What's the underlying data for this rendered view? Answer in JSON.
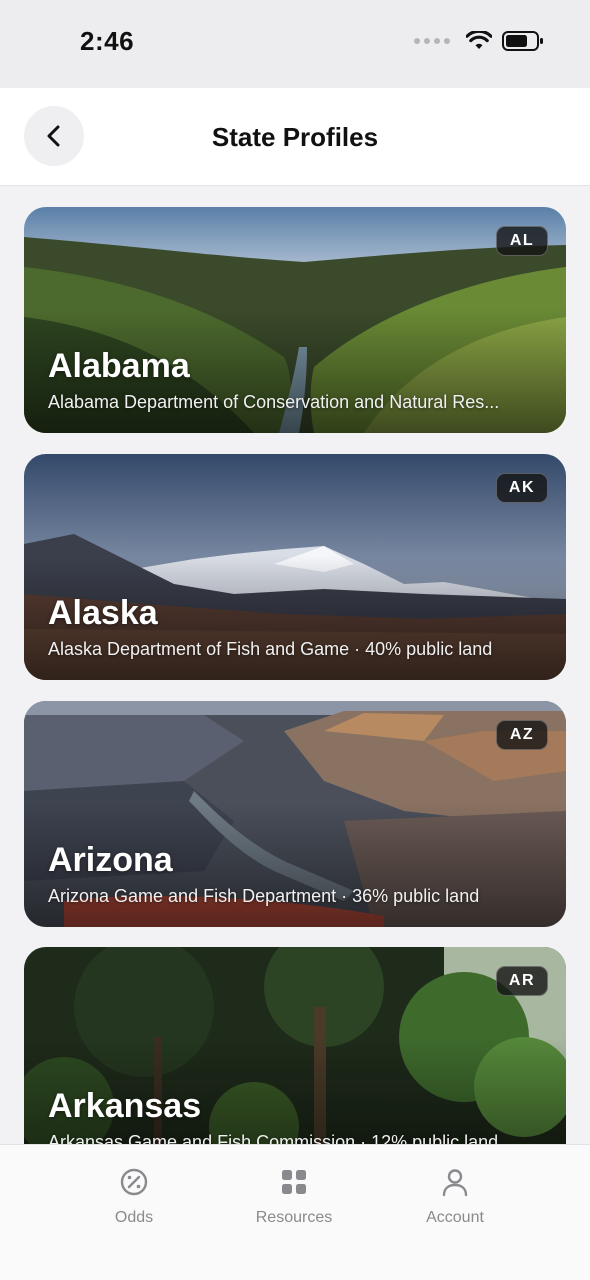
{
  "status": {
    "time": "2:46"
  },
  "header": {
    "title": "State Profiles"
  },
  "states": [
    {
      "name": "Alabama",
      "code": "AL",
      "subtitle": "Alabama Department of Conservation and Natural Res..."
    },
    {
      "name": "Alaska",
      "code": "AK",
      "subtitle": "Alaska Department of Fish and Game · 40% public land"
    },
    {
      "name": "Arizona",
      "code": "AZ",
      "subtitle": "Arizona Game and Fish Department · 36% public land"
    },
    {
      "name": "Arkansas",
      "code": "AR",
      "subtitle": "Arkansas Game and Fish Commission · 12% public land"
    }
  ],
  "tabs": [
    {
      "label": "Odds",
      "icon": "percent-icon"
    },
    {
      "label": "Resources",
      "icon": "grid-icon"
    },
    {
      "label": "Account",
      "icon": "person-icon"
    }
  ],
  "colors": {
    "inactive_tab": "#8a8a8e",
    "badge_bg": "#121212"
  }
}
